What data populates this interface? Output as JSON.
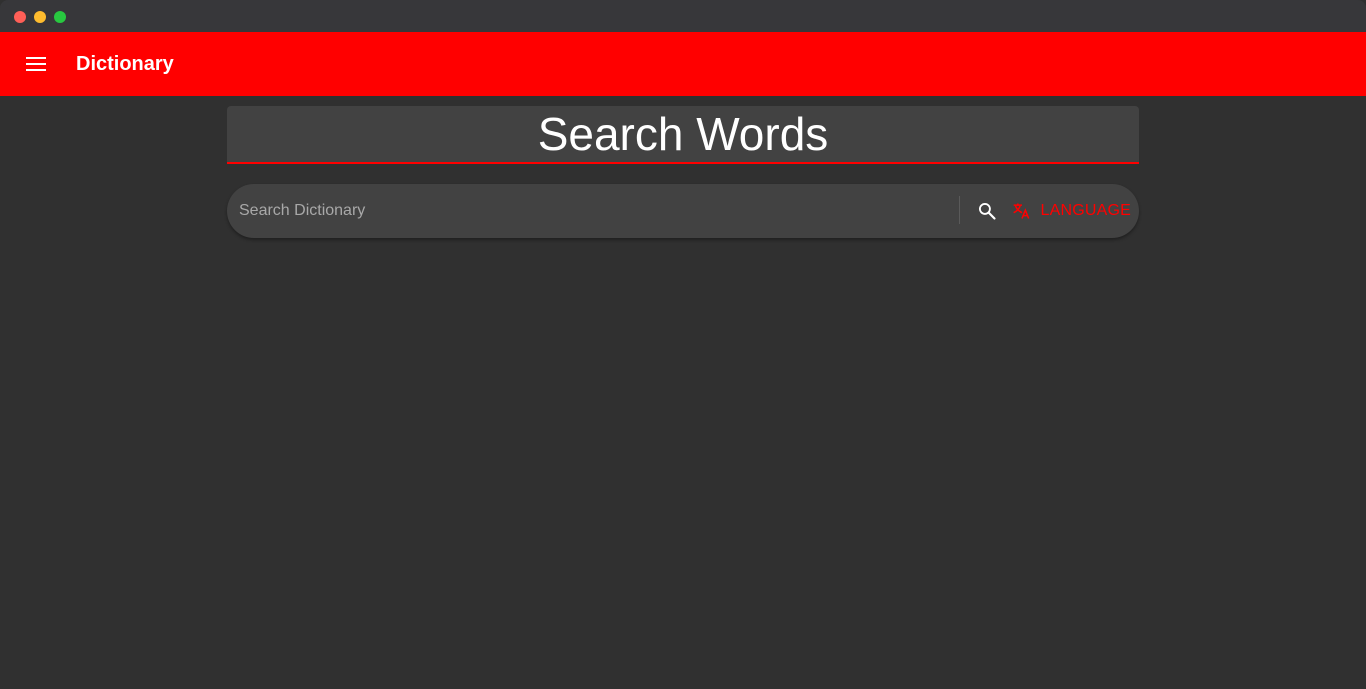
{
  "colors": {
    "accent": "#ff0000",
    "background": "#303030",
    "surface": "#424242",
    "titlebar": "#37373a"
  },
  "titlebar": {
    "buttons": [
      "close",
      "minimize",
      "maximize"
    ]
  },
  "appbar": {
    "menu_icon": "menu-icon",
    "title": "Dictionary"
  },
  "main": {
    "heading": "Search Words",
    "search": {
      "value": "",
      "placeholder": "Search Dictionary",
      "search_icon": "search-icon",
      "language_icon": "translate-icon",
      "language_label": "LANGUAGE"
    }
  }
}
